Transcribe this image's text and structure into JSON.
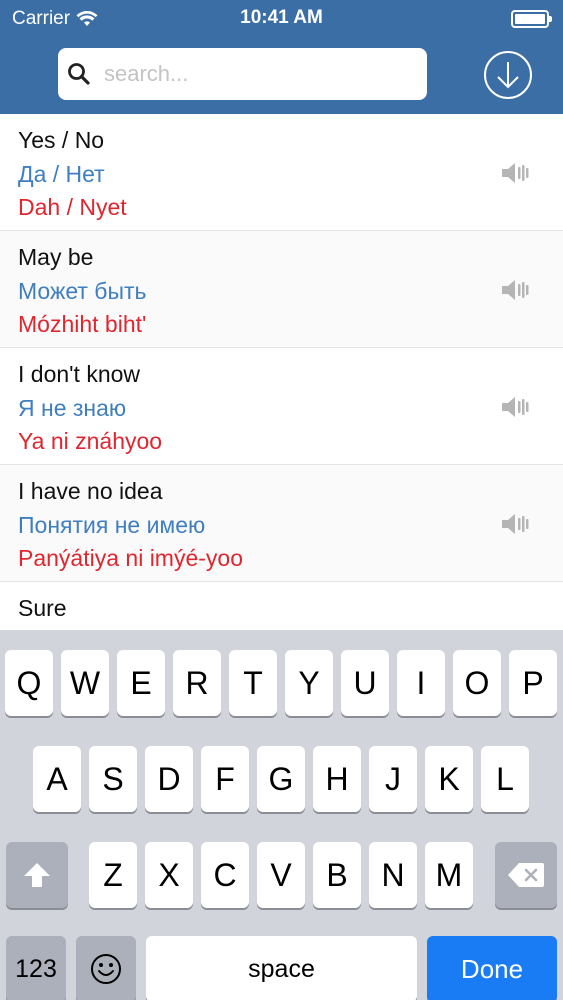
{
  "status": {
    "carrier": "Carrier",
    "time": "10:41 AM"
  },
  "search": {
    "placeholder": "search..."
  },
  "phrases": [
    {
      "english": "Yes / No",
      "russian": "Да / Нет",
      "transliteration": "Dah / Nyet"
    },
    {
      "english": "May be",
      "russian": "Может быть",
      "transliteration": "Mózhiht biht'"
    },
    {
      "english": "I don't know",
      "russian": "Я не знаю",
      "transliteration": "Ya ni znáhyoo"
    },
    {
      "english": "I have no idea",
      "russian": "Понятия не имею",
      "transliteration": "Panýátiya ni imýé-yoo"
    },
    {
      "english": "Sure",
      "russian": "",
      "transliteration": ""
    }
  ],
  "keyboard": {
    "row1": [
      "Q",
      "W",
      "E",
      "R",
      "T",
      "Y",
      "U",
      "I",
      "O",
      "P"
    ],
    "row2": [
      "A",
      "S",
      "D",
      "F",
      "G",
      "H",
      "J",
      "K",
      "L"
    ],
    "row3": [
      "Z",
      "X",
      "C",
      "V",
      "B",
      "N",
      "M"
    ],
    "numbers_label": "123",
    "space_label": "space",
    "done_label": "Done"
  },
  "colors": {
    "header": "#3a6ea5",
    "russian_text": "#3f7fbf",
    "transliteration_text": "#e0262f",
    "done_key": "#1a7cf5"
  }
}
